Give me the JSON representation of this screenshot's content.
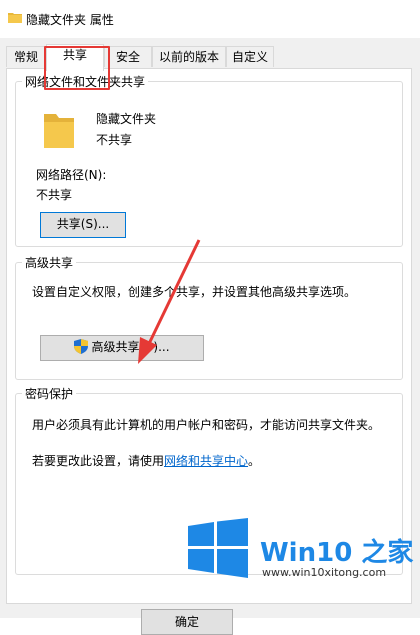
{
  "window": {
    "title": "隐藏文件夹 属性"
  },
  "tabs": [
    {
      "label": "常规"
    },
    {
      "label": "共享"
    },
    {
      "label": "安全"
    },
    {
      "label": "以前的版本"
    },
    {
      "label": "自定义"
    }
  ],
  "network_sharing": {
    "title": "网络文件和文件夹共享",
    "folder_name": "隐藏文件夹",
    "folder_status": "不共享",
    "path_label": "网络路径(N):",
    "path_value": "不共享",
    "share_button": "共享(S)..."
  },
  "advanced_sharing": {
    "title": "高级共享",
    "description": "设置自定义权限，创建多个共享，并设置其他高级共享选项。",
    "button": "高级共享(D)..."
  },
  "password_protection": {
    "title": "密码保护",
    "description": "用户必须具有此计算机的用户帐户和密码，才能访问共享文件夹。",
    "change_prefix": "若要更改此设置，请使用",
    "change_link": "网络和共享中心",
    "change_suffix": "。"
  },
  "footer": {
    "ok_button": "确定"
  },
  "watermark": {
    "brand_en": "Win10",
    "brand_zh": "之家",
    "url": "www.win10xitong.com"
  },
  "colors": {
    "highlight": "#e53935",
    "link": "#0066cc",
    "accent": "#0078d7",
    "folder": "#f5c84c",
    "watermark": "#1e88e5"
  }
}
